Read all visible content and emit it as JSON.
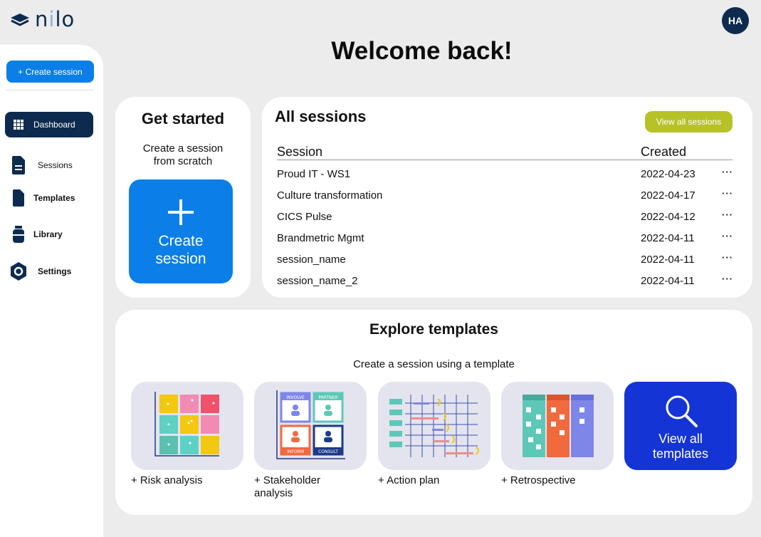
{
  "app": {
    "logo_text_a": "n",
    "logo_text_b": "i",
    "logo_text_c": "lo",
    "user_initials": "HA"
  },
  "sidebar": {
    "create_label": "+ Create session",
    "items": [
      {
        "label": "Dashboard",
        "icon": "grid-icon",
        "active": true
      },
      {
        "label": "Sessions",
        "icon": "document-icon"
      },
      {
        "label": "Templates",
        "icon": "file-icon"
      },
      {
        "label": "Library",
        "icon": "jar-icon"
      },
      {
        "label": "Settings",
        "icon": "gear-icon"
      }
    ]
  },
  "page": {
    "title": "Welcome back!"
  },
  "get_started": {
    "title": "Get started",
    "subtitle_1": "Create a session",
    "subtitle_2": "from scratch",
    "button_line1": "Create",
    "button_line2": "session"
  },
  "all_sessions": {
    "title": "All sessions",
    "view_all": "View all sessions",
    "col_session": "Session",
    "col_created": "Created",
    "more_label": "···",
    "rows": [
      {
        "name": "Proud IT - WS1",
        "created": "2022-04-23"
      },
      {
        "name": "Culture transformation",
        "created": "2022-04-17"
      },
      {
        "name": "CICS Pulse",
        "created": "2022-04-12"
      },
      {
        "name": "Brandmetric Mgmt",
        "created": "2022-04-11"
      },
      {
        "name": "session_name",
        "created": "2022-04-11"
      },
      {
        "name": "session_name_2",
        "created": "2022-04-11"
      }
    ]
  },
  "explore": {
    "title": "Explore templates",
    "subtitle": "Create a session using a template",
    "templates": [
      {
        "label": "+ Risk analysis"
      },
      {
        "label_1": "+ Stakeholder",
        "label_2": "analysis",
        "quadrants": [
          "INVOLVE",
          "PARTNER",
          "INFORM",
          "CONSULT"
        ]
      },
      {
        "label": "+ Action plan"
      },
      {
        "label": "+ Retrospective"
      }
    ],
    "view_all_line1": "View all",
    "view_all_line2": "templates"
  },
  "colors": {
    "primary": "#0b7fe7",
    "navy": "#0d2b4e",
    "accent_olive": "#b6c228",
    "templates_blue": "#1434d6"
  }
}
